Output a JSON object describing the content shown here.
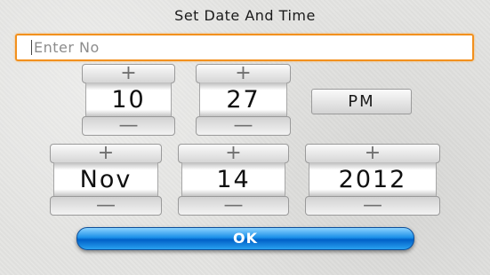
{
  "dialog": {
    "title": "Set Date And Time"
  },
  "number_input": {
    "placeholder": "Enter No",
    "value": ""
  },
  "time": {
    "hour": {
      "value": "10",
      "increment_label": "+",
      "decrement_label": "—"
    },
    "minute": {
      "value": "27",
      "increment_label": "+",
      "decrement_label": "—"
    },
    "ampm_label": "PM"
  },
  "date": {
    "month": {
      "value": "Nov",
      "increment_label": "+",
      "decrement_label": "—"
    },
    "day": {
      "value": "14",
      "increment_label": "+",
      "decrement_label": "—"
    },
    "year": {
      "value": "2012",
      "increment_label": "+",
      "decrement_label": "—"
    }
  },
  "actions": {
    "ok_label": "OK"
  },
  "colors": {
    "input_focus_border": "#f2901d",
    "ok_button": "#1a8fe8"
  }
}
